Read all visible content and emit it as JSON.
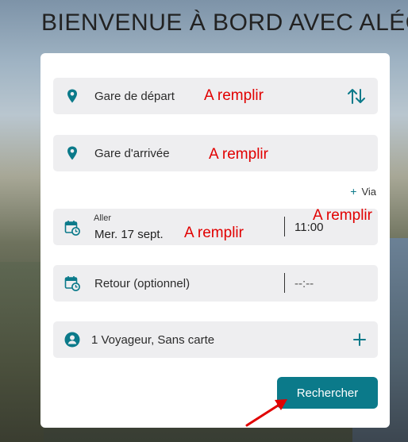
{
  "header": {
    "title": "BIENVENUE À BORD AVEC ALÉO"
  },
  "form": {
    "departure": {
      "placeholder": "Gare de départ",
      "icon": "location-pin-icon"
    },
    "swap": {
      "icon": "swap-arrows-icon"
    },
    "arrival": {
      "placeholder": "Gare d'arrivée",
      "icon": "location-pin-icon"
    },
    "via": {
      "plus": "+",
      "label": "Via"
    },
    "outbound": {
      "small_label": "Aller",
      "date": "Mer. 17 sept.",
      "time": "11:00",
      "icon": "calendar-clock-icon"
    },
    "return": {
      "placeholder": "Retour (optionnel)",
      "time_placeholder": "--:--",
      "icon": "calendar-clock-icon"
    },
    "passengers": {
      "label": "1 Voyageur, Sans carte",
      "icon": "user-icon",
      "add_icon": "plus-icon"
    },
    "search_button": "Rechercher"
  },
  "annotations": {
    "fill_note": "A remplir"
  },
  "colors": {
    "accent": "#0b7a8a",
    "field_bg": "#eeeef0",
    "annotation": "#e10000"
  }
}
